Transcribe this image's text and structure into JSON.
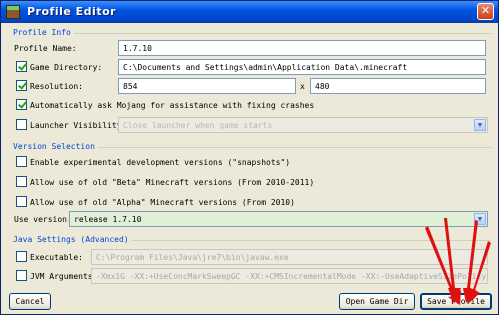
{
  "window": {
    "title": "Profile Editor",
    "close_glyph": "✕"
  },
  "profile_info": {
    "section_title": "Profile Info",
    "profile_name_label": "Profile Name:",
    "profile_name_value": "1.7.10",
    "game_dir_label": "Game Directory:",
    "game_dir_value": "C:\\Documents and Settings\\admin\\Application Data\\.minecraft",
    "game_dir_checked": true,
    "resolution_label": "Resolution:",
    "resolution_checked": true,
    "resolution_width": "854",
    "resolution_x": "x",
    "resolution_height": "480",
    "mojang_label": "Automatically ask Mojang for assistance with fixing crashes",
    "mojang_checked": true,
    "launcher_visibility_label": "Launcher Visibility:",
    "launcher_visibility_checked": false,
    "launcher_visibility_value": "Close launcher when game starts"
  },
  "version_selection": {
    "section_title": "Version Selection",
    "snapshots_label": "Enable experimental development versions (\"snapshots\")",
    "beta_label": "Allow use of old \"Beta\" Minecraft versions (From 2010-2011)",
    "alpha_label": "Allow use of old \"Alpha\" Minecraft versions (From 2010)",
    "use_version_label": "Use version:",
    "use_version_value": "release 1.7.10"
  },
  "java_settings": {
    "section_title": "Java Settings (Advanced)",
    "executable_label": "Executable:",
    "executable_checked": false,
    "executable_value": "C:\\Program Files\\Java\\jre7\\bin\\javaw.exe",
    "jvm_label": "JVM Arguments:",
    "jvm_checked": false,
    "jvm_value": "-Xmx1G -XX:+UseConcMarkSweepGC -XX:+CMSIncrementalMode -XX:-UseAdaptiveSizePolicy -Xmn128M"
  },
  "buttons": {
    "cancel": "Cancel",
    "open_game_dir": "Open Game Dir",
    "save_profile": "Save Profile"
  },
  "colors": {
    "title_bar": "#0054e3",
    "section_title": "#0046d5",
    "arrow": "#e01010"
  }
}
